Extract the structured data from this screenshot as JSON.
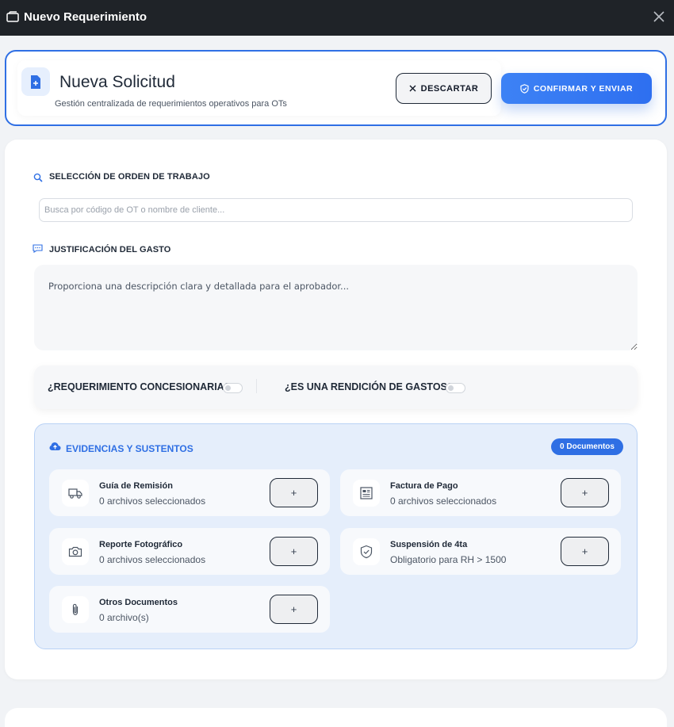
{
  "window": {
    "title": "Nuevo Requerimiento"
  },
  "header": {
    "title": "Nueva Solicitud",
    "subtitle": "Gestión centralizada de requerimientos operativos para OTs",
    "discard_label": "DESCARTAR",
    "confirm_label": "CONFIRMAR Y ENVIAR"
  },
  "work_order": {
    "label": "SELECCIÓN DE ORDEN DE TRABAJO",
    "placeholder": "Busca por código de OT o nombre de cliente..."
  },
  "justification": {
    "label": "JUSTIFICACIÓN DEL GASTO",
    "placeholder": "Proporciona una descripción clara y detallada para el aprobador..."
  },
  "toggles": {
    "concessionaire_label": "¿REQUERIMIENTO CONCESIONARIA?",
    "concessionaire_on": false,
    "expense_report_label": "¿ES UNA RENDICIÓN DE GASTOS?",
    "expense_report_on": false
  },
  "evidence": {
    "title": "EVIDENCIAS Y SUSTENTOS",
    "badge": "0 Documentos",
    "add_symbol": "+",
    "items": [
      {
        "title": "Guía de Remisión",
        "subtitle": "0 archivos seleccionados",
        "icon": "truck-icon"
      },
      {
        "title": "Factura de Pago",
        "subtitle": "0 archivos seleccionados",
        "icon": "invoice-icon"
      },
      {
        "title": "Reporte Fotográfico",
        "subtitle": "0 archivos seleccionados",
        "icon": "camera-icon"
      },
      {
        "title": "Suspensión de 4ta",
        "subtitle": "Obligatorio para RH > 1500",
        "icon": "shield-check-icon"
      },
      {
        "title": "Otros Documentos",
        "subtitle": "0 archivo(s)",
        "icon": "paperclip-icon"
      }
    ]
  },
  "colors": {
    "accent": "#2f6fe4",
    "titlebar": "#1f2328",
    "evidence_bg": "#e5eefb"
  }
}
